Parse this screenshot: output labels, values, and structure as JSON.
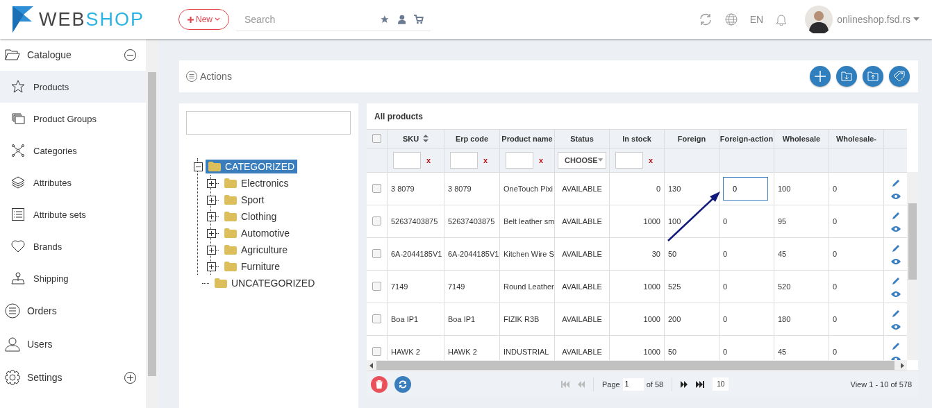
{
  "header": {
    "logo": {
      "dark": "WEB",
      "light": "SHOP"
    },
    "new_button": "New",
    "search": {
      "placeholder": "Search"
    },
    "language": "EN",
    "user": "onlineshop.fsd.rs"
  },
  "sidebar": {
    "items": [
      {
        "label": "Catalogue",
        "expanded": true,
        "children": [
          {
            "label": "Products",
            "selected": true
          },
          {
            "label": "Product Groups",
            "selected": false
          },
          {
            "label": "Categories",
            "selected": false
          },
          {
            "label": "Attributes",
            "selected": false
          },
          {
            "label": "Attribute sets",
            "selected": false
          },
          {
            "label": "Brands",
            "selected": false
          },
          {
            "label": "Shipping",
            "selected": false
          }
        ]
      },
      {
        "label": "Orders"
      },
      {
        "label": "Users"
      },
      {
        "label": "Settings",
        "expanded": false
      }
    ]
  },
  "actions": {
    "title": "Actions"
  },
  "tree": {
    "nodes": [
      {
        "label": "CATEGORIZED",
        "expanded": true,
        "selected": true,
        "children": [
          {
            "label": "Electronics",
            "expanded": false,
            "selected": false
          },
          {
            "label": "Sport",
            "expanded": false,
            "selected": false
          },
          {
            "label": "Clothing",
            "expanded": false,
            "selected": false
          },
          {
            "label": "Automotive",
            "expanded": false,
            "selected": false
          },
          {
            "label": "Agriculture",
            "expanded": false,
            "selected": false
          },
          {
            "label": "Furniture",
            "expanded": false,
            "selected": false
          }
        ]
      },
      {
        "label": "UNCATEGORIZED",
        "selected": false
      }
    ]
  },
  "table": {
    "title": "All products",
    "select_all": {
      "checked": false
    },
    "columns": [
      {
        "label": "SKU",
        "sortable": true,
        "filter": {
          "kind": "text",
          "clear": "x"
        }
      },
      {
        "label": "Erp code",
        "filter": {
          "kind": "text",
          "clear": "x"
        }
      },
      {
        "label": "Product name",
        "filter": {
          "kind": "text",
          "clear": "x"
        }
      },
      {
        "label": "Status",
        "filter": {
          "kind": "select",
          "value": "CHOOSE"
        }
      },
      {
        "label": "In stock",
        "filter": {
          "kind": "text",
          "clear": "x"
        }
      },
      {
        "label": "Foreign"
      },
      {
        "label": "Foreign-action"
      },
      {
        "label": "Wholesale"
      },
      {
        "label": "Wholesale-"
      }
    ],
    "rows": [
      {
        "checked": false,
        "editing": true,
        "cells": [
          "3 8079",
          "3 8079",
          "OneTouch Pixi",
          "AVAILABLE",
          "0",
          "130",
          "0",
          "100",
          "0"
        ]
      },
      {
        "checked": false,
        "editing": false,
        "cells": [
          "52637403875",
          "52637403875",
          "Belt leather sm",
          "AVAILABLE",
          "1000",
          "100",
          "0",
          "95",
          "0"
        ]
      },
      {
        "checked": false,
        "editing": false,
        "cells": [
          "6A-2044185V1",
          "6A-2044185V1",
          "Kitchen Wire S",
          "AVAILABLE",
          "30",
          "50",
          "0",
          "45",
          "0"
        ]
      },
      {
        "checked": false,
        "editing": false,
        "cells": [
          "7149",
          "7149",
          "Round Leather",
          "AVAILABLE",
          "1000",
          "525",
          "0",
          "520",
          "0"
        ]
      },
      {
        "checked": false,
        "editing": false,
        "cells": [
          "Boa IP1",
          "Boa IP1",
          "FIZIK R3B",
          "AVAILABLE",
          "1000",
          "200",
          "0",
          "180",
          "0"
        ]
      },
      {
        "checked": false,
        "editing": false,
        "cells": [
          "HAWK 2",
          "HAWK 2",
          "INDUSTRIAL",
          "AVAILABLE",
          "1000",
          "50",
          "0",
          "45",
          "0"
        ]
      }
    ]
  },
  "pager": {
    "page_label": "Page",
    "page": "1",
    "of": "of 58",
    "page_size": "10",
    "view": "View 1 - 10 of 578"
  }
}
